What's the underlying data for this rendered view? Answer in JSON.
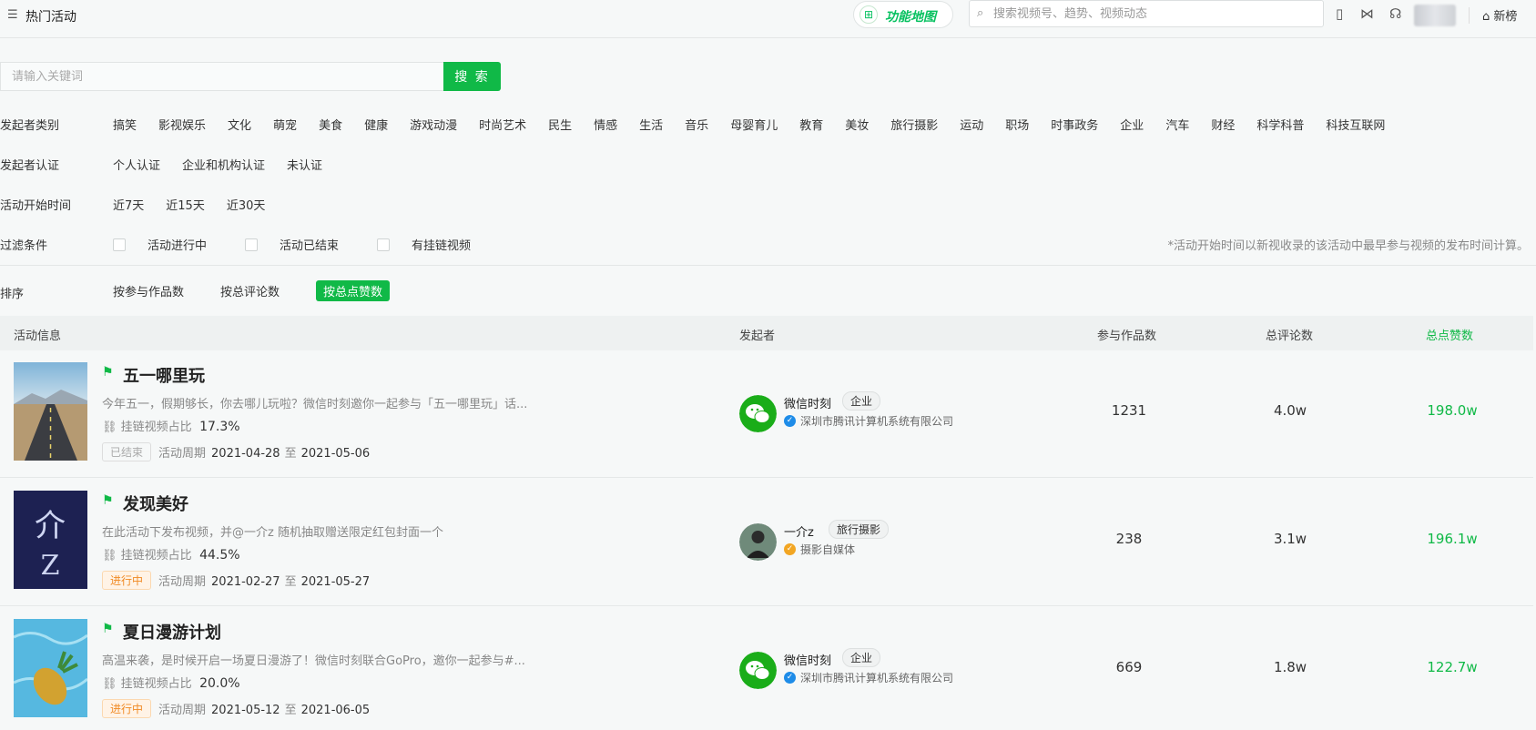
{
  "header": {
    "page_title": "热门活动",
    "func_map_label": "功能地图",
    "search_placeholder": "搜索视频号、趋势、视频动态",
    "newrank_label": "新榜"
  },
  "keyword_search": {
    "placeholder": "请输入关键词",
    "button_label": "搜 索"
  },
  "filters": {
    "category": {
      "label": "发起者类别",
      "options": [
        "搞笑",
        "影视娱乐",
        "文化",
        "萌宠",
        "美食",
        "健康",
        "游戏动漫",
        "时尚艺术",
        "民生",
        "情感",
        "生活",
        "音乐",
        "母婴育儿",
        "教育",
        "美妆",
        "旅行摄影",
        "运动",
        "职场",
        "时事政务",
        "企业",
        "汽车",
        "财经",
        "科学科普",
        "科技互联网"
      ]
    },
    "certification": {
      "label": "发起者认证",
      "options": [
        "个人认证",
        "企业和机构认证",
        "未认证"
      ]
    },
    "start_time": {
      "label": "活动开始时间",
      "options": [
        "近7天",
        "近15天",
        "近30天"
      ]
    },
    "conditions": {
      "label": "过滤条件",
      "options": [
        "活动进行中",
        "活动已结束",
        "有挂链视频"
      ],
      "note": "*活动开始时间以新视收录的该活动中最早参与视频的发布时间计算。"
    }
  },
  "sort": {
    "label": "排序",
    "options": [
      "按参与作品数",
      "按总评论数",
      "按总点赞数"
    ],
    "active_index": 2
  },
  "table": {
    "headers": {
      "activity": "活动信息",
      "organizer": "发起者",
      "works": "参与作品数",
      "comments": "总评论数",
      "likes": "总点赞数"
    },
    "ratio_label": "挂链视频占比",
    "period_label": "活动周期",
    "period_sep": "至",
    "rows": [
      {
        "title": "五一哪里玩",
        "desc": "今年五一，假期够长，你去哪儿玩啦？微信时刻邀你一起参与「五一哪里玩」话...",
        "ratio": "17.3%",
        "status": "已结束",
        "start": "2021-04-28",
        "end": "2021-05-06",
        "org_name": "微信时刻",
        "org_tag": "企业",
        "org_sub": "深圳市腾讯计算机系统有限公司",
        "works": "1231",
        "comments": "4.0w",
        "likes": "198.0w"
      },
      {
        "title": "发现美好",
        "desc": "在此活动下发布视频，并@一介z 随机抽取赠送限定红包封面一个",
        "ratio": "44.5%",
        "status": "进行中",
        "start": "2021-02-27",
        "end": "2021-05-27",
        "org_name": "一介z",
        "org_tag": "旅行摄影",
        "org_sub": "摄影自媒体",
        "works": "238",
        "comments": "3.1w",
        "likes": "196.1w"
      },
      {
        "title": "夏日漫游计划",
        "desc": "高温来袭，是时候开启一场夏日漫游了！微信时刻联合GoPro，邀你一起参与#...",
        "ratio": "20.0%",
        "status": "进行中",
        "start": "2021-05-12",
        "end": "2021-06-05",
        "org_name": "微信时刻",
        "org_tag": "企业",
        "org_sub": "深圳市腾讯计算机系统有限公司",
        "works": "669",
        "comments": "1.8w",
        "likes": "122.7w"
      }
    ]
  },
  "colors": {
    "accent_green": "#10b947",
    "status_running": "#f08a24",
    "verify_blue": "#1e8ce8",
    "verify_gold": "#f2a623"
  }
}
